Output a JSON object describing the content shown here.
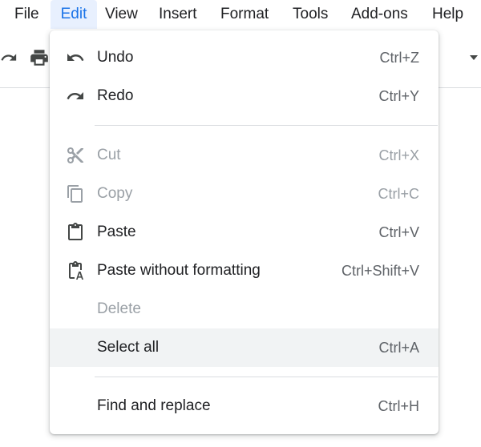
{
  "menubar": {
    "items": [
      {
        "label": "File"
      },
      {
        "label": "Edit"
      },
      {
        "label": "View"
      },
      {
        "label": "Insert"
      },
      {
        "label": "Format"
      },
      {
        "label": "Tools"
      },
      {
        "label": "Add-ons"
      },
      {
        "label": "Help"
      }
    ],
    "active": "Edit"
  },
  "edit_menu": {
    "items": [
      {
        "label": "Undo",
        "shortcut": "Ctrl+Z",
        "icon": "undo-icon",
        "enabled": true
      },
      {
        "label": "Redo",
        "shortcut": "Ctrl+Y",
        "icon": "redo-icon",
        "enabled": true
      },
      {
        "label": "Cut",
        "shortcut": "Ctrl+X",
        "icon": "cut-icon",
        "enabled": false
      },
      {
        "label": "Copy",
        "shortcut": "Ctrl+C",
        "icon": "copy-icon",
        "enabled": false
      },
      {
        "label": "Paste",
        "shortcut": "Ctrl+V",
        "icon": "paste-icon",
        "enabled": true
      },
      {
        "label": "Paste without formatting",
        "shortcut": "Ctrl+Shift+V",
        "icon": "paste-plain-icon",
        "enabled": true
      },
      {
        "label": "Delete",
        "shortcut": "",
        "icon": "",
        "enabled": false
      },
      {
        "label": "Select all",
        "shortcut": "Ctrl+A",
        "icon": "",
        "enabled": true,
        "hovered": true
      },
      {
        "label": "Find and replace",
        "shortcut": "Ctrl+H",
        "icon": "",
        "enabled": true
      }
    ]
  },
  "colors": {
    "active_menu_bg": "#e8f0fe",
    "active_menu_text": "#1a73e8",
    "hover_bg": "#f1f3f4",
    "disabled_text": "#9aa0a6",
    "text": "#202124",
    "shortcut_text": "#5f6368"
  }
}
